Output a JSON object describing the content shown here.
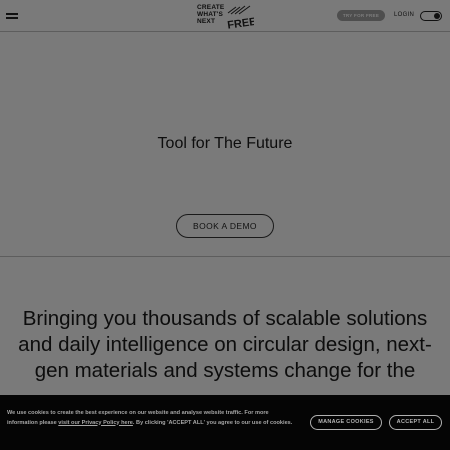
{
  "header": {
    "logo_lines": [
      "CREATE",
      "WHAT'S",
      "NEXT"
    ],
    "logo_badge": "FREE",
    "trial_button_label": "TRY FOR FREE",
    "login_label": "LOGIN"
  },
  "hero": {
    "title": "Tool for The Future",
    "demo_button_label": "BOOK A DEMO"
  },
  "mission": {
    "text": "Bringing you thousands of scalable solutions and daily intelligence on circular design, next-gen materials and systems change for the"
  },
  "cookie_banner": {
    "text_before_link": "We use cookies to create the best experience on our website and analyse website traffic. For more information please ",
    "policy_link_label": "visit our Privacy Policy here",
    "text_after_link": ". By clicking 'ACCEPT ALL' you agree to our use of cookies.",
    "manage_button_label": "MANAGE COOKIES",
    "accept_button_label": "ACCEPT ALL"
  },
  "colors": {
    "page_background": "#7a7a7a",
    "cookie_background": "#050505",
    "text": "#0d0d0d"
  }
}
